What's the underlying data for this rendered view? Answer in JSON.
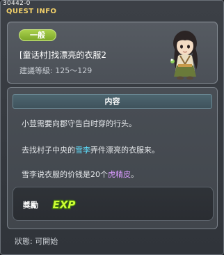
{
  "window": {
    "quest_id": "30442-0",
    "title": "QUEST INFO"
  },
  "header": {
    "badge": "一般",
    "quest_title": "[童话村]找漂亮的衣服2",
    "recommended_level": "建議等級: 125～129"
  },
  "content": {
    "section_title": "内容",
    "lines": [
      {
        "parts": [
          "小荳需要向郡守告白时穿的行头。"
        ]
      },
      {
        "parts": [
          "去找村子中央的",
          "雪李",
          "弄件漂亮的衣服来。"
        ]
      },
      {
        "parts": [
          "雪李说衣服的价钱是20个",
          "虎精皮",
          "。"
        ]
      }
    ],
    "highlight_colors": {
      "npc": "#5fe0ff",
      "item": "#d99bff"
    }
  },
  "reward": {
    "label": "獎勵",
    "exp_icon_text": "EXP",
    "exp_icon": "exp-icon"
  },
  "footer": {
    "status": "狀態: 可開始"
  },
  "colors": {
    "title": "#f3d16a",
    "badge": "#8fbb35",
    "section_header": "#45606a"
  }
}
